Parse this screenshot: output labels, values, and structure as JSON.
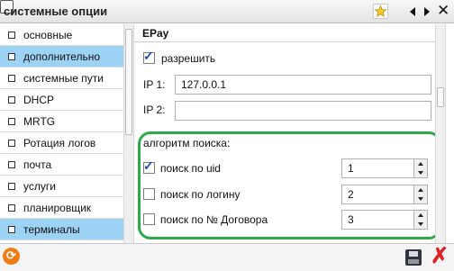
{
  "window": {
    "title": "системные опции",
    "close_glyph": "✕"
  },
  "toolbar": {
    "icons": [
      "star-icon",
      "window-icon",
      "arrow-left-icon",
      "arrow-right-icon",
      "close-icon"
    ]
  },
  "sidebar": {
    "items": [
      {
        "label": "основные",
        "selected": false
      },
      {
        "label": "дополнительно",
        "selected": true
      },
      {
        "label": "системные пути",
        "selected": false
      },
      {
        "label": "DHCP",
        "selected": false
      },
      {
        "label": "MRTG",
        "selected": false
      },
      {
        "label": "Ротация логов",
        "selected": false
      },
      {
        "label": "почта",
        "selected": false
      },
      {
        "label": "услуги",
        "selected": false
      },
      {
        "label": "планировщик",
        "selected": false
      },
      {
        "label": "терминалы",
        "selected": true
      }
    ]
  },
  "panel": {
    "title": "EPay",
    "enable": {
      "label": "разрешить",
      "checked": true
    },
    "ip1": {
      "label": "IP 1:",
      "value": "127.0.0.1"
    },
    "ip2": {
      "label": "IP 2:",
      "value": ""
    },
    "search": {
      "heading": "алгоритм поиска:",
      "options": [
        {
          "label": "поиск по uid",
          "checked": true,
          "value": "1"
        },
        {
          "label": "поиск по логину",
          "checked": false,
          "value": "2"
        },
        {
          "label": "поиск по № Договора",
          "checked": false,
          "value": "3"
        }
      ]
    }
  },
  "checkmark": "✓",
  "colors": {
    "selection": "#9cd2f3",
    "group_border": "#2ea84a",
    "refresh": "#ef7d13",
    "delete": "#e02020"
  },
  "footer": {
    "icons": [
      "refresh-icon",
      "save-icon",
      "delete-icon"
    ],
    "delete_glyph": "✗",
    "refresh_glyph": "⟳"
  }
}
